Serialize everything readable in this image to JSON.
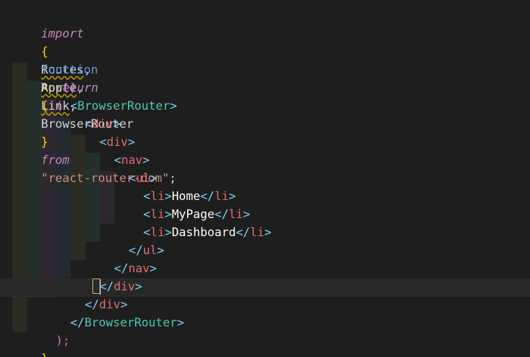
{
  "code": {
    "import": {
      "keyword": "import",
      "open_brace": "{",
      "names": [
        "Routes",
        "Route",
        "Link",
        "BrowserRouter"
      ],
      "close_brace": "}",
      "from": "from",
      "module": "\"react-router-dom\"",
      "semicolon": ";"
    },
    "function_line": {
      "keyword": "function",
      "name": "App",
      "parens": "()",
      "open_brace": "{"
    },
    "return_line": {
      "keyword": "return",
      "paren": "("
    },
    "jsx": {
      "browser_router_open": "BrowserRouter",
      "div_outer_open": "div",
      "div_inner_open": "div",
      "nav_open": "nav",
      "ul_open": "ul",
      "li_items": [
        "Home",
        "MyPage",
        "Dashboard"
      ],
      "li_tag": "li",
      "ul_close": "ul",
      "nav_close": "nav",
      "div_inner_close": "div",
      "div_outer_close": "div",
      "browser_router_close": "BrowserRouter"
    },
    "close_paren_semicolon": ");",
    "close_brace": "}"
  },
  "colors": {
    "background": "#1e1e1e",
    "keyword_purple": "#c586c0",
    "keyword_blue": "#569cd6",
    "string": "#ce9178",
    "component_tag": "#4ec9b0",
    "html_tag": "#e06c75",
    "bracket_yellow": "#ffd700"
  }
}
